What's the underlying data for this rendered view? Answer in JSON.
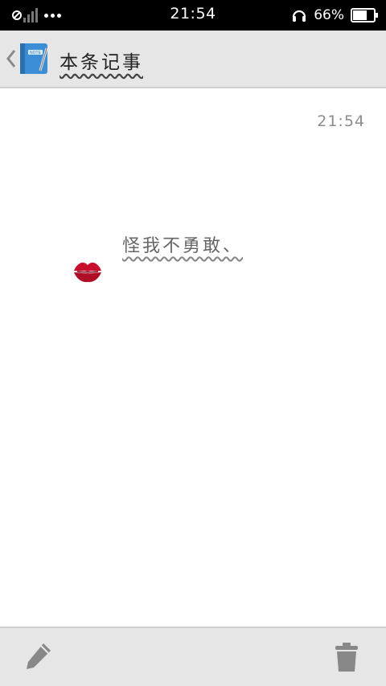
{
  "status_bar": {
    "time": "21:54",
    "battery": "66%",
    "icons": [
      "no-sim-icon",
      "signal-icon",
      "more-dots-icon",
      "headset-icon",
      "battery-icon"
    ]
  },
  "header": {
    "title": "本条记事",
    "icons": [
      "back-chevron-icon",
      "notebook-icon"
    ]
  },
  "note": {
    "time": "21:54",
    "text": "怪我不勇敢、",
    "sticker": "kiss-lips-icon"
  },
  "bottom_bar": {
    "icons": [
      "edit-pencil-icon",
      "delete-trash-icon"
    ]
  },
  "colors": {
    "status_bar_bg": "#000000",
    "header_bg": "#e6e6e6",
    "lips": "#c8102e",
    "notebook_blue": "#3b8ed6"
  }
}
